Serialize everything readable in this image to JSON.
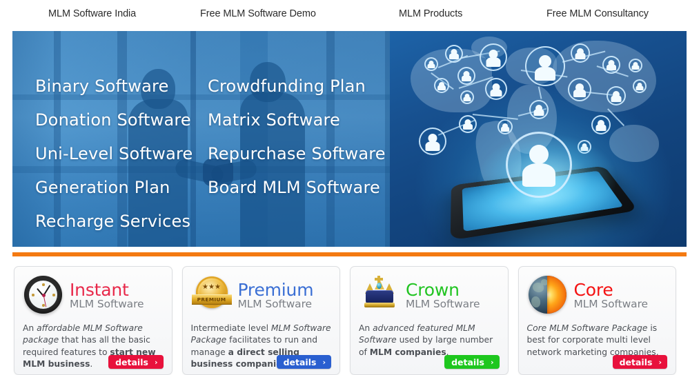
{
  "nav": {
    "items": [
      {
        "label": "MLM Software India"
      },
      {
        "label": "Free MLM Software Demo"
      },
      {
        "label": "MLM Products"
      },
      {
        "label": "Free MLM Consultancy"
      }
    ]
  },
  "hero": {
    "column_left": [
      {
        "label": "Binary Software"
      },
      {
        "label": "Donation Software"
      },
      {
        "label": "Uni-Level Software"
      },
      {
        "label": "Generation Plan"
      },
      {
        "label": "Recharge Services"
      }
    ],
    "column_right": [
      {
        "label": "Crowdfunding Plan"
      },
      {
        "label": "Matrix Software"
      },
      {
        "label": "Repurchase Software"
      },
      {
        "label": "Board MLM Software"
      }
    ],
    "graphic": {
      "left_scene": "business-handshake-photo",
      "right_scene": "global-network-tablet-graphic"
    }
  },
  "divider": {
    "color": "#f47a11"
  },
  "cards": [
    {
      "icon": "clock-icon",
      "title": "Instant",
      "title_color": "#e8294a",
      "subtitle": "MLM Software",
      "desc_parts": [
        {
          "text": "An ",
          "style": "normal"
        },
        {
          "text": "affordable MLM Software package",
          "style": "italic"
        },
        {
          "text": " that has all the basic required features to ",
          "style": "normal"
        },
        {
          "text": "start new MLM business",
          "style": "bold"
        },
        {
          "text": ".",
          "style": "normal"
        }
      ],
      "button": {
        "label": "details",
        "chevron": "›",
        "color": "#e8113c"
      }
    },
    {
      "icon": "premium-badge-icon",
      "icon_text": "PREMIUM",
      "title": "Premium",
      "title_color": "#3b6fd4",
      "subtitle": "MLM Software",
      "desc_parts": [
        {
          "text": "Intermediate level ",
          "style": "normal"
        },
        {
          "text": "MLM Software Package",
          "style": "italic"
        },
        {
          "text": " facilitates to run and manage ",
          "style": "normal"
        },
        {
          "text": "a direct selling business companies",
          "style": "bold"
        },
        {
          "text": ".",
          "style": "normal"
        }
      ],
      "button": {
        "label": "details",
        "chevron": "›",
        "color": "#2a5fd0"
      }
    },
    {
      "icon": "crown-icon",
      "title": "Crown",
      "title_color": "#22c422",
      "subtitle": "MLM Software",
      "desc_parts": [
        {
          "text": "An ",
          "style": "normal"
        },
        {
          "text": "advanced featured MLM Software",
          "style": "italic"
        },
        {
          "text": " used by large number of ",
          "style": "normal"
        },
        {
          "text": "MLM companies",
          "style": "bold"
        },
        {
          "text": ".",
          "style": "normal"
        }
      ],
      "button": {
        "label": "details",
        "chevron": "›",
        "color": "#1ec71e"
      }
    },
    {
      "icon": "earth-core-icon",
      "title": "Core",
      "title_color": "#f41212",
      "subtitle": "MLM Software",
      "desc_parts": [
        {
          "text": "Core MLM Software Package",
          "style": "italic"
        },
        {
          "text": " is best for corporate multi level network marketing companies.",
          "style": "normal"
        }
      ],
      "button": {
        "label": "details",
        "chevron": "›",
        "color": "#e8113c"
      }
    }
  ]
}
